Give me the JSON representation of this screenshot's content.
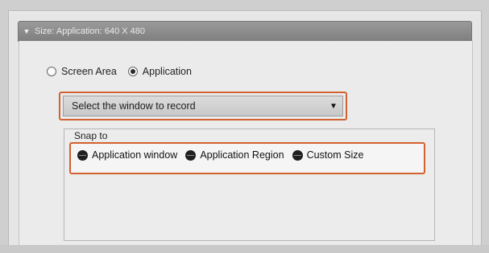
{
  "section": {
    "toggle_icon": "triangle-down-icon",
    "title": "Size: Application: 640 X 480"
  },
  "capture_mode": {
    "options": [
      {
        "label": "Screen Area",
        "selected": false
      },
      {
        "label": "Application",
        "selected": true
      }
    ]
  },
  "window_select": {
    "value": "Select the window to record",
    "caret_icon": "dropdown-arrow-icon"
  },
  "snap_to": {
    "label": "Snap to",
    "options": [
      {
        "label": "Application window",
        "icon": "snap-button-icon"
      },
      {
        "label": "Application Region",
        "icon": "snap-button-icon"
      },
      {
        "label": "Custom Size",
        "icon": "snap-button-icon"
      }
    ]
  },
  "colors": {
    "highlight": "#d2622f",
    "header": "#8c8c8c"
  }
}
